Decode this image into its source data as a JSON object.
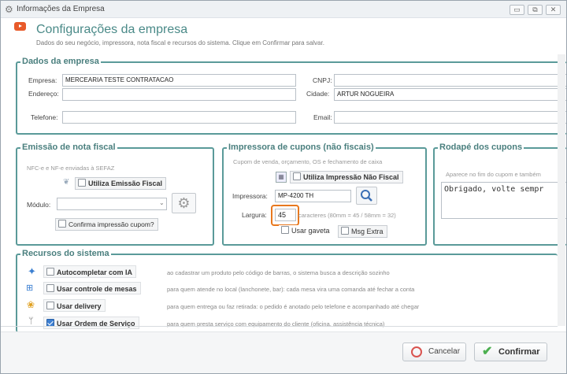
{
  "window": {
    "title": "Informações da Empresa",
    "btn_min": "▭",
    "btn_max": "⧉",
    "btn_close": "✕"
  },
  "header": {
    "title": "Configurações da empresa",
    "subtitle": "Dados do seu negócio, impressora, nota fiscal e recursos do sistema. Clique em Confirmar para salvar."
  },
  "empresa": {
    "legend": "Dados da empresa",
    "empresa_label": "Empresa:",
    "empresa_value": "MERCEARIA TESTE CONTRATACAO",
    "cnpj_label": "CNPJ:",
    "cnpj_value": "",
    "endereco_label": "Endereço:",
    "endereco_value": "",
    "cidade_label": "Cidade:",
    "cidade_value": "ARTUR NOGUEIRA",
    "telefone_label": "Telefone:",
    "telefone_value": "",
    "email_label": "Email:",
    "email_value": ""
  },
  "nota": {
    "legend": "Emissão de nota fiscal",
    "hint": "NFC-e e NF-e enviadas à SEFAZ",
    "utiliza_label": "Utiliza Emissão Fiscal",
    "modulo_label": "Módulo:",
    "modulo_value": "",
    "confirma_label": "Confirma impressão cupom?"
  },
  "impressora": {
    "legend": "Impressora de cupons (não fiscais)",
    "hint": "Cupom de venda, orçamento, OS e fechamento de caixa",
    "utiliza_label": "Utiliza Impressão Não Fiscal",
    "impressora_label": "Impressora:",
    "impressora_value": "MP-4200 TH",
    "largura_label": "Largura:",
    "largura_value": "45",
    "largura_hint": "caracteres (80mm = 45 / 58mm = 32)",
    "gaveta_label": "Usar gaveta",
    "msg_label": "Msg Extra"
  },
  "rodape": {
    "legend": "Rodapé dos cupons",
    "hint": "Aparece no fim do cupom e também",
    "text": "Obrigado, volte sempr"
  },
  "recursos": {
    "legend": "Recursos do sistema",
    "rows": [
      {
        "label": "Autocompletar com IA",
        "desc": "ao cadastrar um produto pelo código de barras, o sistema busca a descrição sozinho",
        "checked": false,
        "icon": "sparkle-icon"
      },
      {
        "label": "Usar controle de mesas",
        "desc": "para quem atende no local (lanchonete, bar): cada mesa vira uma comanda até fechar a conta",
        "checked": false,
        "icon": "table-icon"
      },
      {
        "label": "Usar delivery",
        "desc": "para quem entrega ou faz retirada: o pedido é anotado pelo telefone e acompanhado até chegar",
        "checked": false,
        "icon": "delivery-icon"
      },
      {
        "label": "Usar Ordem de Serviço",
        "desc": "para quem presta serviço com equipamento do cliente (oficina, assistência técnica)",
        "checked": true,
        "icon": "wrench-icon"
      }
    ]
  },
  "footer": {
    "cancel_label": "Cancelar",
    "confirm_label": "Confirmar"
  },
  "colors": {
    "accent": "#4a8a88",
    "highlight": "#e8781e",
    "title_icon": "#e85a2a"
  }
}
